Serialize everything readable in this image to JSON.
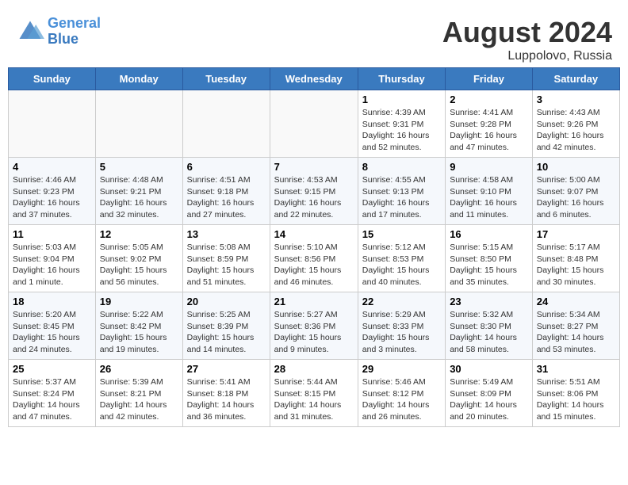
{
  "header": {
    "month_year": "August 2024",
    "location": "Luppolovo, Russia",
    "logo_line1": "General",
    "logo_line2": "Blue"
  },
  "days_of_week": [
    "Sunday",
    "Monday",
    "Tuesday",
    "Wednesday",
    "Thursday",
    "Friday",
    "Saturday"
  ],
  "weeks": [
    [
      {
        "day": "",
        "info": ""
      },
      {
        "day": "",
        "info": ""
      },
      {
        "day": "",
        "info": ""
      },
      {
        "day": "",
        "info": ""
      },
      {
        "day": "1",
        "info": "Sunrise: 4:39 AM\nSunset: 9:31 PM\nDaylight: 16 hours\nand 52 minutes."
      },
      {
        "day": "2",
        "info": "Sunrise: 4:41 AM\nSunset: 9:28 PM\nDaylight: 16 hours\nand 47 minutes."
      },
      {
        "day": "3",
        "info": "Sunrise: 4:43 AM\nSunset: 9:26 PM\nDaylight: 16 hours\nand 42 minutes."
      }
    ],
    [
      {
        "day": "4",
        "info": "Sunrise: 4:46 AM\nSunset: 9:23 PM\nDaylight: 16 hours\nand 37 minutes."
      },
      {
        "day": "5",
        "info": "Sunrise: 4:48 AM\nSunset: 9:21 PM\nDaylight: 16 hours\nand 32 minutes."
      },
      {
        "day": "6",
        "info": "Sunrise: 4:51 AM\nSunset: 9:18 PM\nDaylight: 16 hours\nand 27 minutes."
      },
      {
        "day": "7",
        "info": "Sunrise: 4:53 AM\nSunset: 9:15 PM\nDaylight: 16 hours\nand 22 minutes."
      },
      {
        "day": "8",
        "info": "Sunrise: 4:55 AM\nSunset: 9:13 PM\nDaylight: 16 hours\nand 17 minutes."
      },
      {
        "day": "9",
        "info": "Sunrise: 4:58 AM\nSunset: 9:10 PM\nDaylight: 16 hours\nand 11 minutes."
      },
      {
        "day": "10",
        "info": "Sunrise: 5:00 AM\nSunset: 9:07 PM\nDaylight: 16 hours\nand 6 minutes."
      }
    ],
    [
      {
        "day": "11",
        "info": "Sunrise: 5:03 AM\nSunset: 9:04 PM\nDaylight: 16 hours\nand 1 minute."
      },
      {
        "day": "12",
        "info": "Sunrise: 5:05 AM\nSunset: 9:02 PM\nDaylight: 15 hours\nand 56 minutes."
      },
      {
        "day": "13",
        "info": "Sunrise: 5:08 AM\nSunset: 8:59 PM\nDaylight: 15 hours\nand 51 minutes."
      },
      {
        "day": "14",
        "info": "Sunrise: 5:10 AM\nSunset: 8:56 PM\nDaylight: 15 hours\nand 46 minutes."
      },
      {
        "day": "15",
        "info": "Sunrise: 5:12 AM\nSunset: 8:53 PM\nDaylight: 15 hours\nand 40 minutes."
      },
      {
        "day": "16",
        "info": "Sunrise: 5:15 AM\nSunset: 8:50 PM\nDaylight: 15 hours\nand 35 minutes."
      },
      {
        "day": "17",
        "info": "Sunrise: 5:17 AM\nSunset: 8:48 PM\nDaylight: 15 hours\nand 30 minutes."
      }
    ],
    [
      {
        "day": "18",
        "info": "Sunrise: 5:20 AM\nSunset: 8:45 PM\nDaylight: 15 hours\nand 24 minutes."
      },
      {
        "day": "19",
        "info": "Sunrise: 5:22 AM\nSunset: 8:42 PM\nDaylight: 15 hours\nand 19 minutes."
      },
      {
        "day": "20",
        "info": "Sunrise: 5:25 AM\nSunset: 8:39 PM\nDaylight: 15 hours\nand 14 minutes."
      },
      {
        "day": "21",
        "info": "Sunrise: 5:27 AM\nSunset: 8:36 PM\nDaylight: 15 hours\nand 9 minutes."
      },
      {
        "day": "22",
        "info": "Sunrise: 5:29 AM\nSunset: 8:33 PM\nDaylight: 15 hours\nand 3 minutes."
      },
      {
        "day": "23",
        "info": "Sunrise: 5:32 AM\nSunset: 8:30 PM\nDaylight: 14 hours\nand 58 minutes."
      },
      {
        "day": "24",
        "info": "Sunrise: 5:34 AM\nSunset: 8:27 PM\nDaylight: 14 hours\nand 53 minutes."
      }
    ],
    [
      {
        "day": "25",
        "info": "Sunrise: 5:37 AM\nSunset: 8:24 PM\nDaylight: 14 hours\nand 47 minutes."
      },
      {
        "day": "26",
        "info": "Sunrise: 5:39 AM\nSunset: 8:21 PM\nDaylight: 14 hours\nand 42 minutes."
      },
      {
        "day": "27",
        "info": "Sunrise: 5:41 AM\nSunset: 8:18 PM\nDaylight: 14 hours\nand 36 minutes."
      },
      {
        "day": "28",
        "info": "Sunrise: 5:44 AM\nSunset: 8:15 PM\nDaylight: 14 hours\nand 31 minutes."
      },
      {
        "day": "29",
        "info": "Sunrise: 5:46 AM\nSunset: 8:12 PM\nDaylight: 14 hours\nand 26 minutes."
      },
      {
        "day": "30",
        "info": "Sunrise: 5:49 AM\nSunset: 8:09 PM\nDaylight: 14 hours\nand 20 minutes."
      },
      {
        "day": "31",
        "info": "Sunrise: 5:51 AM\nSunset: 8:06 PM\nDaylight: 14 hours\nand 15 minutes."
      }
    ]
  ]
}
